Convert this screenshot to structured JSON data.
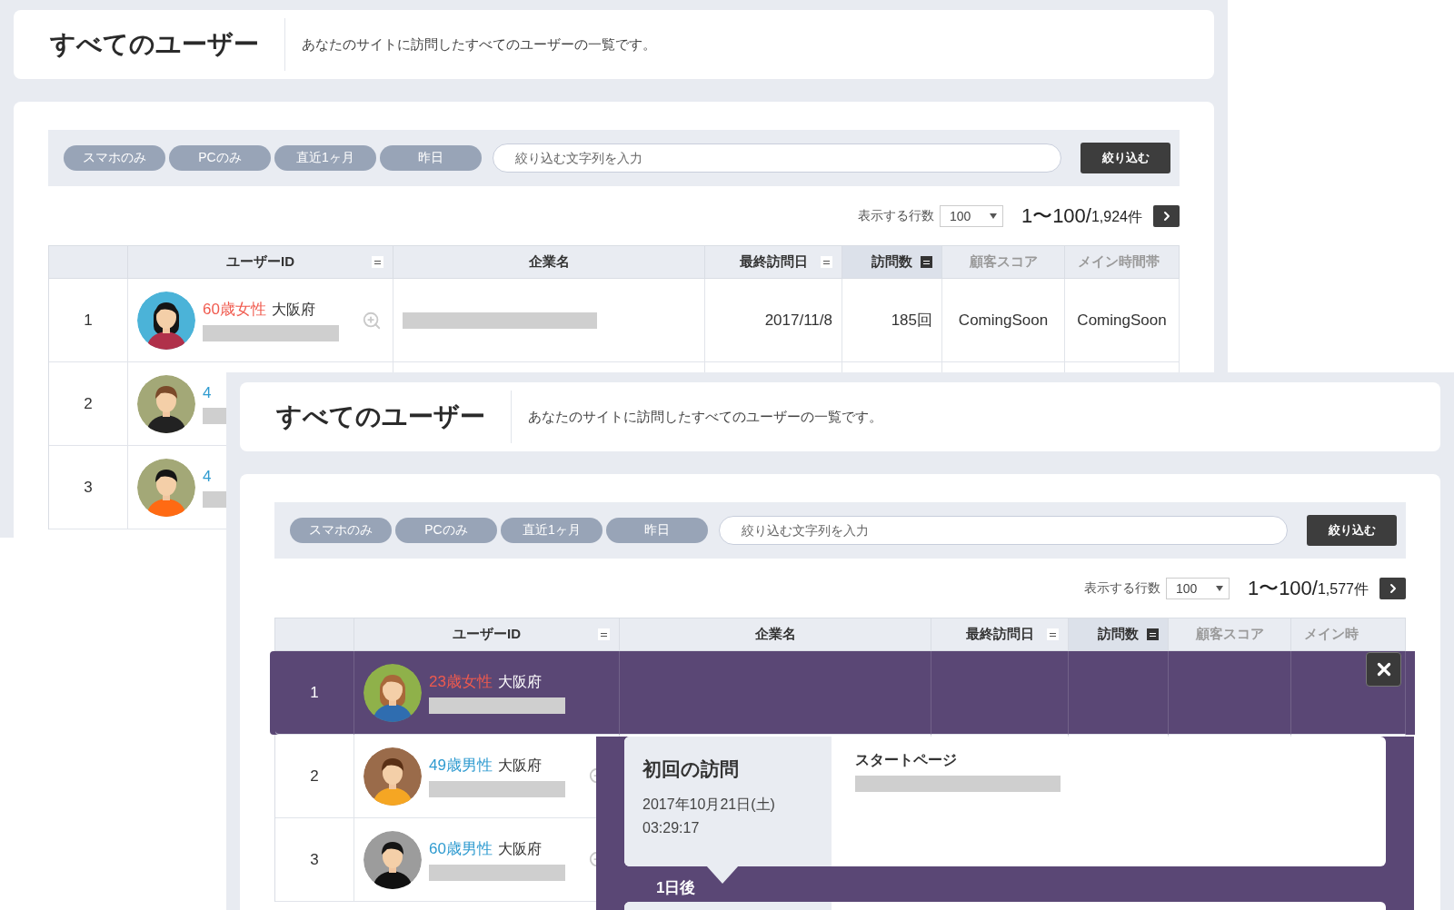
{
  "screens": [
    {
      "header": {
        "title": "すべてのユーザー",
        "description": "あなたのサイトに訪問したすべてのユーザーの一覧です。"
      },
      "filters": [
        {
          "label": "スマホのみ"
        },
        {
          "label": "PCのみ"
        },
        {
          "label": "直近1ヶ月"
        },
        {
          "label": "昨日"
        }
      ],
      "search": {
        "placeholder": "絞り込む文字列を入力"
      },
      "filter_button": "絞り込む",
      "pager": {
        "rows_label": "表示する行数",
        "rows_value": "100",
        "range": "1〜100/",
        "total": "1,924件"
      },
      "columns": [
        {
          "label": "ユーザーID",
          "sortable": true,
          "sorted": false,
          "disabled": false
        },
        {
          "label": "企業名",
          "sortable": false,
          "sorted": false,
          "disabled": false
        },
        {
          "label": "最終訪問日",
          "sortable": true,
          "sorted": false,
          "disabled": false
        },
        {
          "label": "訪問数",
          "sortable": true,
          "sorted": true,
          "disabled": false
        },
        {
          "label": "顧客スコア",
          "sortable": false,
          "sorted": false,
          "disabled": true
        },
        {
          "label": "メイン時間帯",
          "sortable": false,
          "sorted": false,
          "disabled": true
        }
      ],
      "rows": [
        {
          "number": "1",
          "user": "60歳女性",
          "female": true,
          "region": "大阪府",
          "company": {
            "kind": "redacted"
          },
          "last_visit": "2017/11/8",
          "visits": "185回",
          "score": "ComingSoon",
          "time": "ComingSoon",
          "expanded": false
        },
        {
          "number": "2",
          "user": "4",
          "female": false,
          "expanded": false
        },
        {
          "number": "3",
          "user": "4",
          "female": false,
          "expanded": false
        }
      ]
    },
    {
      "header": {
        "title": "すべてのユーザー",
        "description": "あなたのサイトに訪問したすべてのユーザーの一覧です。"
      },
      "filters": [
        {
          "label": "スマホのみ"
        },
        {
          "label": "PCのみ"
        },
        {
          "label": "直近1ヶ月"
        },
        {
          "label": "昨日"
        }
      ],
      "search": {
        "placeholder": "絞り込む文字列を入力"
      },
      "filter_button": "絞り込む",
      "pager": {
        "rows_label": "表示する行数",
        "rows_value": "100",
        "range": "1〜100/",
        "total": "1,577件"
      },
      "columns": [
        {
          "label": "ユーザーID",
          "sortable": true,
          "sorted": false,
          "disabled": false
        },
        {
          "label": "企業名",
          "sortable": false,
          "sorted": false,
          "disabled": false
        },
        {
          "label": "最終訪問日",
          "sortable": true,
          "sorted": false,
          "disabled": false
        },
        {
          "label": "訪問数",
          "sortable": true,
          "sorted": true,
          "disabled": false
        },
        {
          "label": "顧客スコア",
          "sortable": false,
          "sorted": false,
          "disabled": true
        },
        {
          "label": "メイン時",
          "sortable": false,
          "sorted": false,
          "disabled": true
        }
      ],
      "rows": [
        {
          "number": "1",
          "user": "23歳女性",
          "female": true,
          "region": "大阪府",
          "expanded": true
        },
        {
          "number": "2",
          "user": "49歳男性",
          "female": false,
          "region": "大阪府",
          "expanded": false
        },
        {
          "number": "3",
          "user": "60歳男性",
          "female": false,
          "region": "大阪府",
          "expanded": false
        }
      ],
      "detail": {
        "title": "初回の訪問",
        "date": "2017年10月21日(土)",
        "time": "03:29:17",
        "page_label": "スタートページ",
        "gap_label": "1日後"
      }
    }
  ]
}
